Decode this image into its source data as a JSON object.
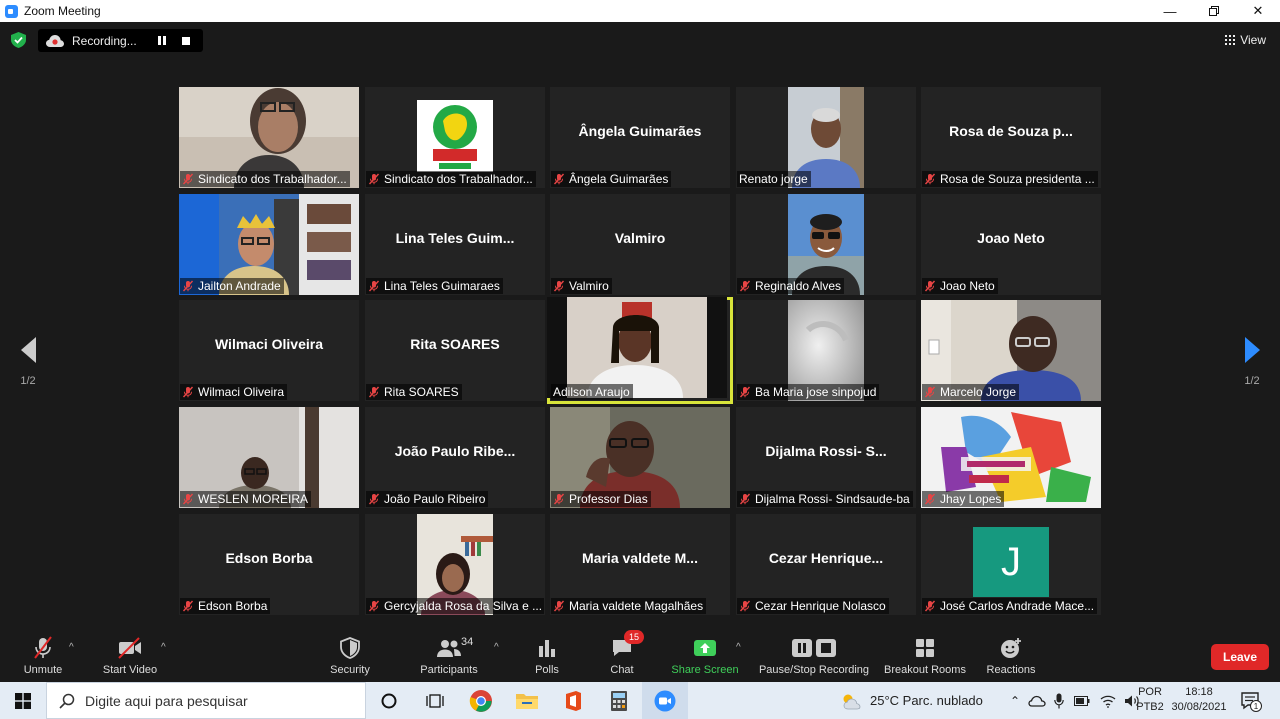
{
  "window": {
    "title": "Zoom Meeting"
  },
  "recording": {
    "status": "Recording..."
  },
  "view": {
    "label": "View"
  },
  "pager": {
    "left": "1/2",
    "right": "1/2"
  },
  "participants": [
    {
      "name": "Sindicato dos Trabalhador...",
      "display": "",
      "video": "woman-glasses"
    },
    {
      "name": "Sindicato dos Trabalhador...",
      "display": "",
      "video": "logo"
    },
    {
      "name": "Ângela Guimarães",
      "display": "Ângela Guimarães"
    },
    {
      "name": "Renato jorge",
      "display": "",
      "video": "man-shirt",
      "muted": false
    },
    {
      "name": "Rosa de Souza presidenta ...",
      "display": "Rosa de Souza p..."
    },
    {
      "name": "Jailton Andrade",
      "display": "",
      "video": "man-crown"
    },
    {
      "name": "Lina Teles Guimaraes",
      "display": "Lina Teles Guim..."
    },
    {
      "name": "Valmiro",
      "display": "Valmiro"
    },
    {
      "name": "Reginaldo Alves",
      "display": "",
      "video": "man-sunglasses"
    },
    {
      "name": "Joao Neto",
      "display": "Joao Neto"
    },
    {
      "name": "Wilmaci Oliveira",
      "display": "Wilmaci Oliveira"
    },
    {
      "name": "Rita SOARES",
      "display": "Rita SOARES"
    },
    {
      "name": "Adilson Araujo",
      "display": "",
      "video": "man-speaking",
      "muted": false,
      "active": true
    },
    {
      "name": "Ba  Maria  jose sinpojud",
      "display": "",
      "video": "light-wall"
    },
    {
      "name": "Marcelo Jorge",
      "display": "",
      "video": "man-glasses"
    },
    {
      "name": "WESLEN MOREIRA",
      "display": "",
      "video": "man-room"
    },
    {
      "name": "João Paulo Ribeiro",
      "display": "João Paulo Ribe..."
    },
    {
      "name": "Professor Dias",
      "display": "",
      "video": "man-close"
    },
    {
      "name": "Dijalma Rossi- Sindsaude-ba",
      "display": "Dijalma Rossi- S..."
    },
    {
      "name": "Jhay Lopes",
      "display": "",
      "video": "poster"
    },
    {
      "name": "Edson Borba",
      "display": "Edson Borba"
    },
    {
      "name": "Gercyjalda Rosa da Silva e ...",
      "display": "",
      "video": "woman-shelf"
    },
    {
      "name": "Maria valdete Magalhães",
      "display": "Maria valdete M..."
    },
    {
      "name": "Cezar Henrique Nolasco",
      "display": "Cezar  Henrique..."
    },
    {
      "name": "José Carlos Andrade Mace...",
      "display": "",
      "video": "avatar-j",
      "avatar_letter": "J"
    }
  ],
  "toolbar": {
    "unmute": "Unmute",
    "start_video": "Start Video",
    "security": "Security",
    "participants": "Participants",
    "participants_count": "34",
    "polls": "Polls",
    "chat": "Chat",
    "chat_badge": "15",
    "share_screen": "Share Screen",
    "pause_stop_recording": "Pause/Stop Recording",
    "breakout_rooms": "Breakout Rooms",
    "reactions": "Reactions",
    "leave": "Leave"
  },
  "taskbar": {
    "search_placeholder": "Digite aqui para pesquisar",
    "weather": "25°C  Parc. nublado",
    "lang_top": "POR",
    "lang_bottom": "PTB2",
    "time": "18:18",
    "date": "30/08/2021",
    "notif_count": "1"
  },
  "colors": {
    "accent": "#2d8cff",
    "share": "#3fcf5a",
    "leave": "#e02828",
    "active_border": "#d8e43a",
    "avatar": "#16997f"
  }
}
